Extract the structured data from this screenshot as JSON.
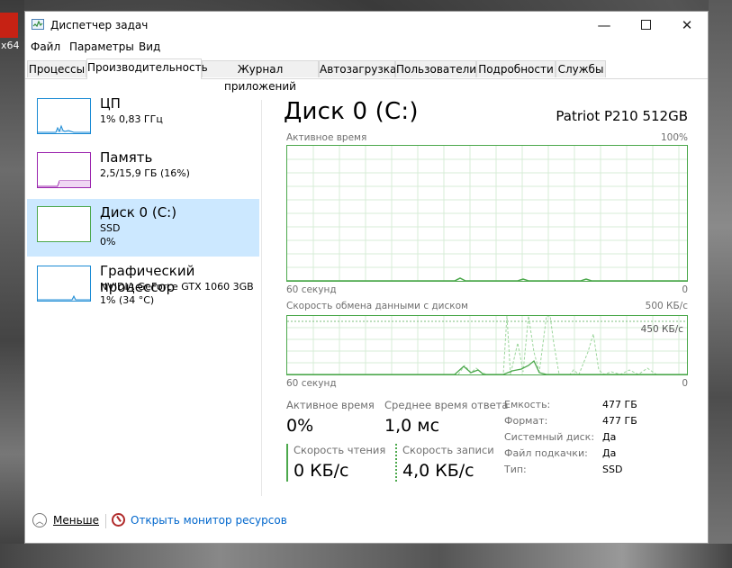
{
  "desktop": {
    "badge_text": "x64"
  },
  "window": {
    "title": "Диспетчер задач"
  },
  "menu": [
    "Файл",
    "Параметры",
    "Вид"
  ],
  "tabs": [
    "Процессы",
    "Производительность",
    "Журнал приложений",
    "Автозагрузка",
    "Пользователи",
    "Подробности",
    "Службы"
  ],
  "active_tab": "Производительность",
  "sidebar": {
    "items": [
      {
        "title": "ЦП",
        "line1": "1% 0,83 ГГц",
        "line2": "",
        "color": "#1a8ad4"
      },
      {
        "title": "Память",
        "line1": "2,5/15,9 ГБ (16%)",
        "line2": "",
        "color": "#9b24ae"
      },
      {
        "title": "Диск 0 (C:)",
        "line1": "SSD",
        "line2": "0%",
        "color": "#4ca84c",
        "selected": true
      },
      {
        "title": "Графический процессор",
        "line1": "NVIDIA GeForce GTX 1060 3GB",
        "line2": "1% (34 °C)",
        "color": "#1a8ad4"
      }
    ]
  },
  "main": {
    "title": "Диск 0 (C:)",
    "model": "Patriot P210 512GB",
    "chart1": {
      "label": "Активное время",
      "max_label": "100%",
      "x_left": "60 секунд",
      "x_right": "0"
    },
    "chart2": {
      "label": "Скорость обмена данными с диском",
      "max_label": "500 КБ/с",
      "marker_label": "450 КБ/с",
      "x_left": "60 секунд",
      "x_right": "0"
    },
    "stats": {
      "active_time_label": "Активное время",
      "active_time_value": "0%",
      "avg_response_label": "Среднее время ответа",
      "avg_response_value": "1,0 мс",
      "read_speed_label": "Скорость чтения",
      "read_speed_value": "0 КБ/с",
      "write_speed_label": "Скорость записи",
      "write_speed_value": "4,0 КБ/с"
    },
    "details": [
      {
        "label": "Емкость:",
        "value": "477 ГБ"
      },
      {
        "label": "Формат:",
        "value": "477 ГБ"
      },
      {
        "label": "Системный диск:",
        "value": "Да"
      },
      {
        "label": "Файл подкачки:",
        "value": "Да"
      },
      {
        "label": "Тип:",
        "value": "SSD"
      }
    ]
  },
  "footer": {
    "less_label": "Меньше",
    "resmon_label": "Открыть монитор ресурсов"
  },
  "colors": {
    "disk": "#4ca84c",
    "selected_bg": "#cce8ff",
    "link": "#0066cc"
  }
}
